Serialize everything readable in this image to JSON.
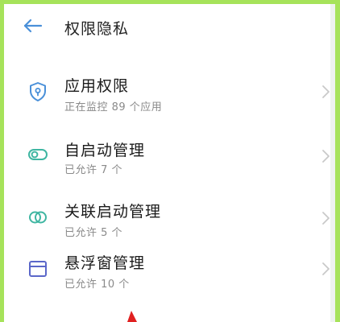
{
  "header": {
    "title": "权限隐私"
  },
  "items": [
    {
      "label": "应用权限",
      "sub": "正在监控 89 个应用",
      "icon": "shield-lock-icon"
    },
    {
      "label": "自启动管理",
      "sub": "已允许 7 个",
      "icon": "toggle-icon"
    },
    {
      "label": "关联启动管理",
      "sub": "已允许 5 个",
      "icon": "linked-rings-icon"
    },
    {
      "label": "悬浮窗管理",
      "sub": "已允许 10 个",
      "icon": "floating-window-icon"
    }
  ],
  "colors": {
    "accent": "#4a90d9",
    "frame": "#a6e35a"
  }
}
